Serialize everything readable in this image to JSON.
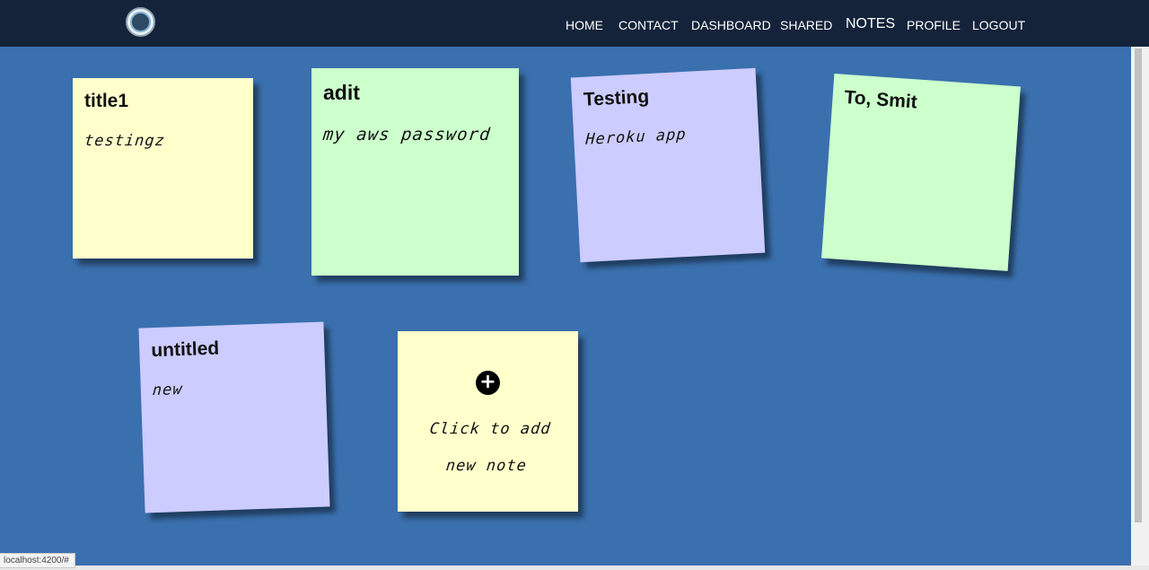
{
  "nav": {
    "links": [
      "HOME",
      "CONTACT",
      "DASHBOARD",
      "SHARED",
      "NOTES",
      "PROFILE",
      "LOGOUT"
    ],
    "active": "NOTES"
  },
  "notes": [
    {
      "title": "title1",
      "body": "testingz",
      "color": "#ffffcc"
    },
    {
      "title": "adit",
      "body": "my aws password",
      "color": "#ccffcc"
    },
    {
      "title": "Testing",
      "body": "Heroku app",
      "color": "#ccccff"
    },
    {
      "title": "To, Smit",
      "body": "",
      "color": "#ccffcc"
    },
    {
      "title": "untitled",
      "body": "new",
      "color": "#ccccff"
    }
  ],
  "add_note": {
    "label": "Click to add new note",
    "icon": "plus-circle-icon",
    "color": "#ffffcc"
  },
  "status_bar": {
    "url": "localhost:4200/#"
  },
  "colors": {
    "background": "#3a70ae",
    "navbar": "#14233a"
  }
}
